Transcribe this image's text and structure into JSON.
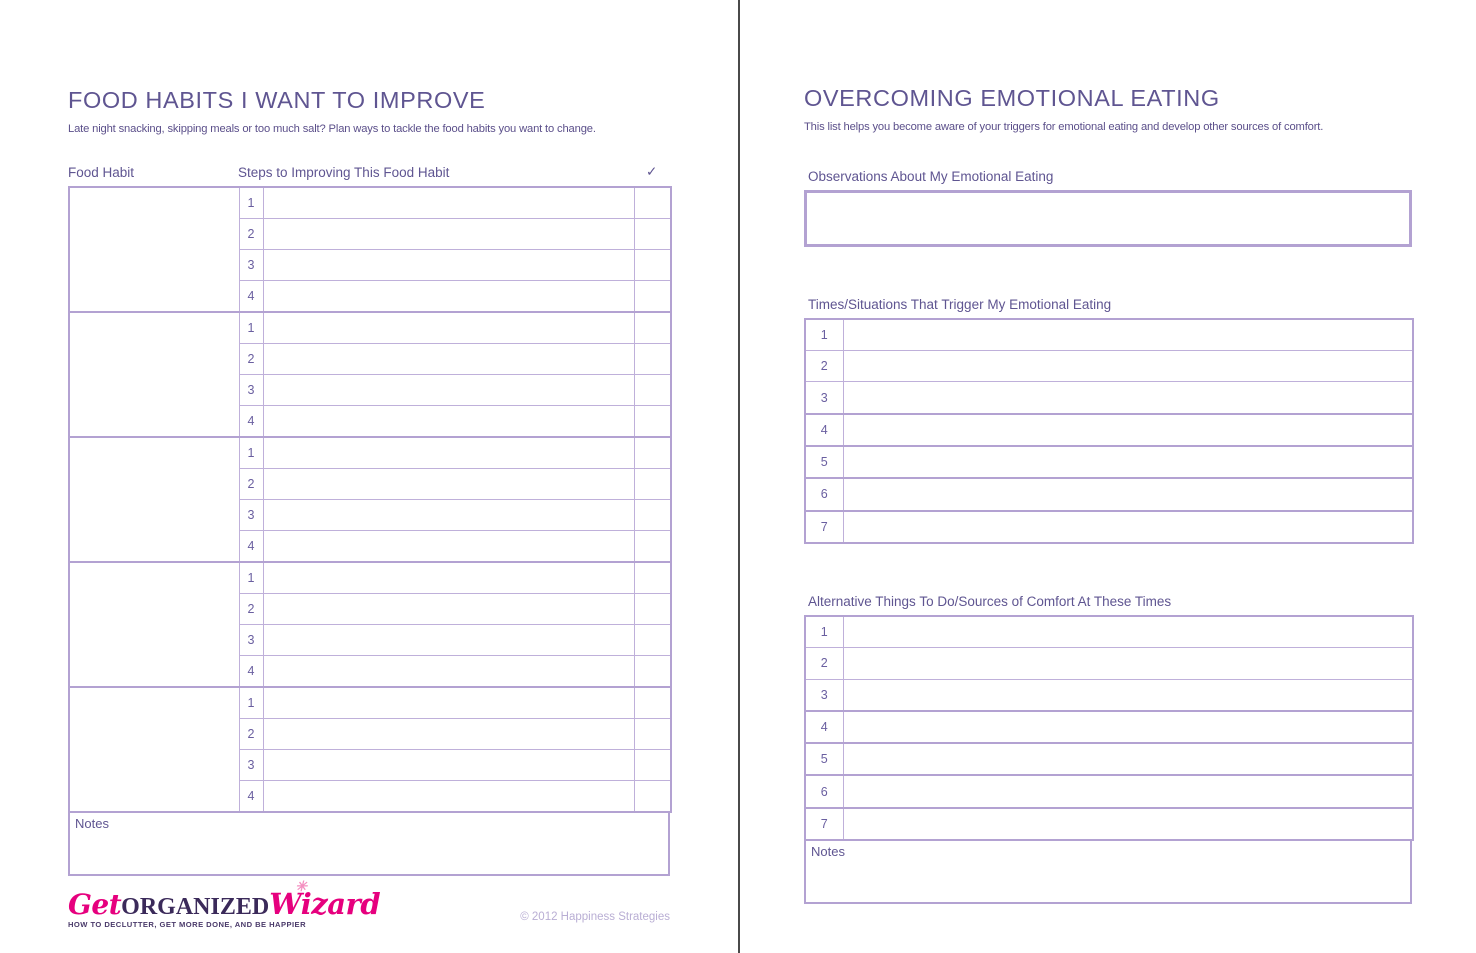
{
  "document": {
    "brand": {
      "logo_get": "Get",
      "logo_organized": "ORGANIZED",
      "logo_wizard": "Wizard",
      "logo_star_icon": "star-icon",
      "tagline": "HOW TO DECLUTTER, GET MORE DONE, AND BE HAPPIER",
      "copyright": "© 2012 Happiness Strategies",
      "accent_pink": "#e6007e",
      "accent_purple": "#5f5591",
      "border_purple": "#b3a2d2",
      "rule_purple": "#bfb0da"
    }
  },
  "left_page": {
    "title": "FOOD HABITS I WANT TO IMPROVE",
    "subtitle": "Late night snacking, skipping meals or too much salt? Plan ways to tackle the food habits you want to change.",
    "columns": {
      "habit": "Food Habit",
      "steps": "Steps to Improving This Food Habit",
      "check": "✓"
    },
    "step_numbers": [
      "1",
      "2",
      "3",
      "4"
    ],
    "habit_group_count": 5,
    "habit_rows": [
      {
        "habit": "",
        "steps": [
          {
            "n": "1",
            "text": "",
            "done": ""
          },
          {
            "n": "2",
            "text": "",
            "done": ""
          },
          {
            "n": "3",
            "text": "",
            "done": ""
          },
          {
            "n": "4",
            "text": "",
            "done": ""
          }
        ]
      },
      {
        "habit": "",
        "steps": [
          {
            "n": "1",
            "text": "",
            "done": ""
          },
          {
            "n": "2",
            "text": "",
            "done": ""
          },
          {
            "n": "3",
            "text": "",
            "done": ""
          },
          {
            "n": "4",
            "text": "",
            "done": ""
          }
        ]
      },
      {
        "habit": "",
        "steps": [
          {
            "n": "1",
            "text": "",
            "done": ""
          },
          {
            "n": "2",
            "text": "",
            "done": ""
          },
          {
            "n": "3",
            "text": "",
            "done": ""
          },
          {
            "n": "4",
            "text": "",
            "done": ""
          }
        ]
      },
      {
        "habit": "",
        "steps": [
          {
            "n": "1",
            "text": "",
            "done": ""
          },
          {
            "n": "2",
            "text": "",
            "done": ""
          },
          {
            "n": "3",
            "text": "",
            "done": ""
          },
          {
            "n": "4",
            "text": "",
            "done": ""
          }
        ]
      },
      {
        "habit": "",
        "steps": [
          {
            "n": "1",
            "text": "",
            "done": ""
          },
          {
            "n": "2",
            "text": "",
            "done": ""
          },
          {
            "n": "3",
            "text": "",
            "done": ""
          },
          {
            "n": "4",
            "text": "",
            "done": ""
          }
        ]
      }
    ],
    "notes_label": "Notes",
    "notes_value": ""
  },
  "right_page": {
    "title": "OVERCOMING EMOTIONAL EATING",
    "subtitle": "This list helps you become aware of your triggers for emotional eating and develop other sources of comfort.",
    "observations": {
      "label": "Observations About My Emotional Eating",
      "value": ""
    },
    "triggers": {
      "label": "Times/Situations That Trigger My Emotional Eating",
      "rows": [
        {
          "n": "1",
          "text": ""
        },
        {
          "n": "2",
          "text": ""
        },
        {
          "n": "3",
          "text": ""
        },
        {
          "n": "4",
          "text": ""
        },
        {
          "n": "5",
          "text": ""
        },
        {
          "n": "6",
          "text": ""
        },
        {
          "n": "7",
          "text": ""
        }
      ]
    },
    "alternatives": {
      "label": "Alternative Things To Do/Sources of Comfort At These Times",
      "rows": [
        {
          "n": "1",
          "text": ""
        },
        {
          "n": "2",
          "text": ""
        },
        {
          "n": "3",
          "text": ""
        },
        {
          "n": "4",
          "text": ""
        },
        {
          "n": "5",
          "text": ""
        },
        {
          "n": "6",
          "text": ""
        },
        {
          "n": "7",
          "text": ""
        }
      ]
    },
    "notes_label": "Notes",
    "notes_value": ""
  }
}
